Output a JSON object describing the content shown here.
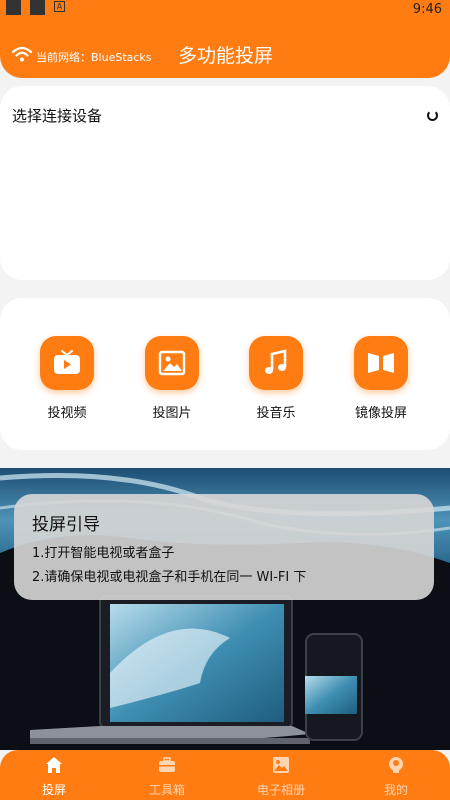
{
  "status_bar": {
    "time": "9:46",
    "a_icon": "A"
  },
  "header": {
    "network": "当前网络：BlueStacks",
    "title": "多功能投屏"
  },
  "device_panel": {
    "label": "选择连接设备"
  },
  "actions": [
    {
      "label": "投视频",
      "icon": "tv-play-icon"
    },
    {
      "label": "投图片",
      "icon": "image-icon"
    },
    {
      "label": "投音乐",
      "icon": "music-note-icon"
    },
    {
      "label": "镜像投屏",
      "icon": "mirror-icon"
    }
  ],
  "guide": {
    "title": "投屏引导",
    "step1": "1.打开智能电视或者盒子",
    "step2": "2.请确保电视或电视盒子和手机在同一 WI-FI 下"
  },
  "tabs": [
    {
      "label": "投屏",
      "icon": "home-icon",
      "active": true
    },
    {
      "label": "工具箱",
      "icon": "toolbox-icon",
      "active": false
    },
    {
      "label": "电子相册",
      "icon": "photo-album-icon",
      "active": false
    },
    {
      "label": "我的",
      "icon": "profile-icon",
      "active": false
    }
  ],
  "colors": {
    "accent": "#ff7c12",
    "background": "#f3f3f3",
    "card": "#ffffff"
  }
}
